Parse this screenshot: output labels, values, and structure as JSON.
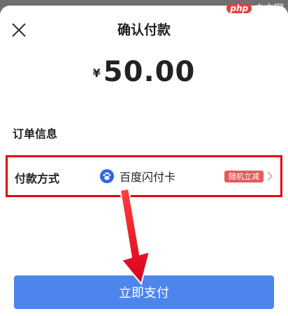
{
  "header": {
    "title": "确认付款",
    "close_icon": "close-icon"
  },
  "payment": {
    "currency_symbol": "¥",
    "amount": "50.00"
  },
  "order": {
    "label": "订单信息"
  },
  "payment_method": {
    "label": "付款方式",
    "method_name": "百度闪付卡",
    "method_icon": "baidu-paw-icon",
    "badge": "随机立减",
    "chevron_icon": "chevron-right-icon"
  },
  "actions": {
    "pay_label": "立即支付"
  },
  "watermark": {
    "php": "php",
    "site": "中文网"
  },
  "colors": {
    "highlight_border": "#e60012",
    "pay_button": "#4c86ec",
    "badge": "#e45b5b",
    "method_icon": "#2f66e0"
  }
}
